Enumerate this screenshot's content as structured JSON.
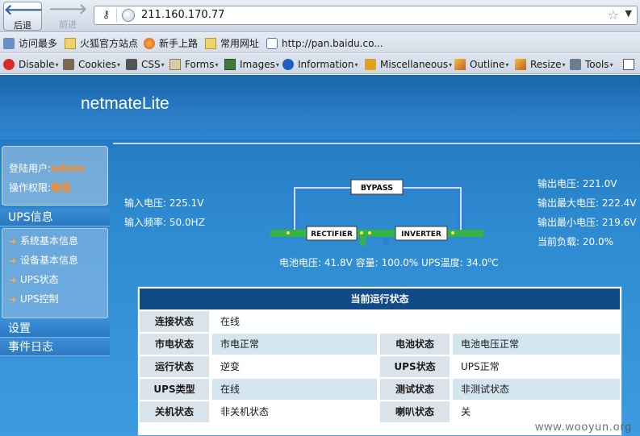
{
  "browser": {
    "back_label": "后退",
    "forward_label": "前进",
    "url": "211.160.170.77",
    "bookmarks": [
      "访问最多",
      "火狐官方站点",
      "新手上路",
      "常用网址",
      "http://pan.baidu.co..."
    ],
    "devtools": [
      "Disable",
      "Cookies",
      "CSS",
      "Forms",
      "Images",
      "Information",
      "Miscellaneous",
      "Outline",
      "Resize",
      "Tools"
    ]
  },
  "header": {
    "title": "netmateLite"
  },
  "sidebar": {
    "user_label": "登陆用户:",
    "user_value": "admin",
    "perm_label": "操作权限:",
    "perm_value": "管理",
    "ups_section": "UPS信息",
    "menu": [
      "系统基本信息",
      "设备基本信息",
      "UPS状态",
      "UPS控制"
    ],
    "settings": "设置",
    "events": "事件日志"
  },
  "diagram": {
    "bypass": "BYPASS",
    "rectifier": "RECTIFIER",
    "inverter": "INVERTER"
  },
  "readings": {
    "input_voltage": "输入电压: 225.1V",
    "input_freq": "输入频率: 50.0HZ",
    "output_voltage": "输出电压: 221.0V",
    "output_max": "输出最大电压: 222.4V",
    "output_min": "输出最小电压: 219.6V",
    "load": "当前负载: 20.0%",
    "battery_line": "电池电压: 41.8V 容量: 100.0% UPS温度: 34.0",
    "temp_unit": "C"
  },
  "status": {
    "title": "当前运行状态",
    "rows": [
      {
        "k1": "连接状态",
        "v1": "在线"
      },
      {
        "k1": "市电状态",
        "v1": "市电正常",
        "k2": "电池状态",
        "v2": "电池电压正常"
      },
      {
        "k1": "运行状态",
        "v1": "逆变",
        "k2": "UPS状态",
        "v2": "UPS正常"
      },
      {
        "k1": "UPS类型",
        "v1": "在线",
        "k2": "测试状态",
        "v2": "非测试状态"
      },
      {
        "k1": "关机状态",
        "v1": "非关机状态",
        "k2": "喇叭状态",
        "v2": "关"
      }
    ]
  },
  "watermark": "www.wooyun.org"
}
